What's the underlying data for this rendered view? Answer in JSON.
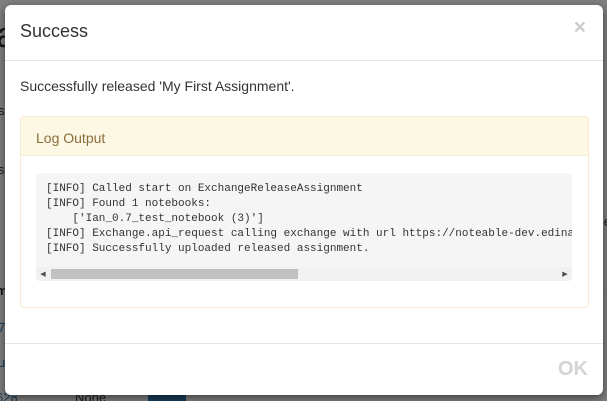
{
  "modal": {
    "title": "Success",
    "close_label": "×",
    "message": "Successfully released 'My First Assignment'.",
    "panel_heading": "Log Output",
    "log_lines": [
      "[INFO] Called start on ExchangeReleaseAssignment",
      "[INFO] Found 1 notebooks:",
      "    ['Ian_0.7_test_notebook (3)']",
      "[INFO] Exchange.api_request calling exchange with url https://noteable-dev.edina.ac.uk/services/ngexchange/assignment?course_id=",
      "[INFO] Successfully uploaded released assignment."
    ],
    "ok_label": "OK",
    "scroll_left_icon": "◀",
    "scroll_right_icon": "▶"
  },
  "background": {
    "a": "a",
    "s1": "s",
    "s2": "s",
    "m": "m",
    "l7": "7",
    "u": "u",
    "n628": "628",
    "none": "None",
    "e": "e",
    "r": "r"
  },
  "colors": {
    "panel_heading_bg": "#fcf8e3",
    "panel_heading_text": "#8a6d3b",
    "panel_border": "#faebcc",
    "overlay": "rgba(0,0,0,0.5)"
  }
}
